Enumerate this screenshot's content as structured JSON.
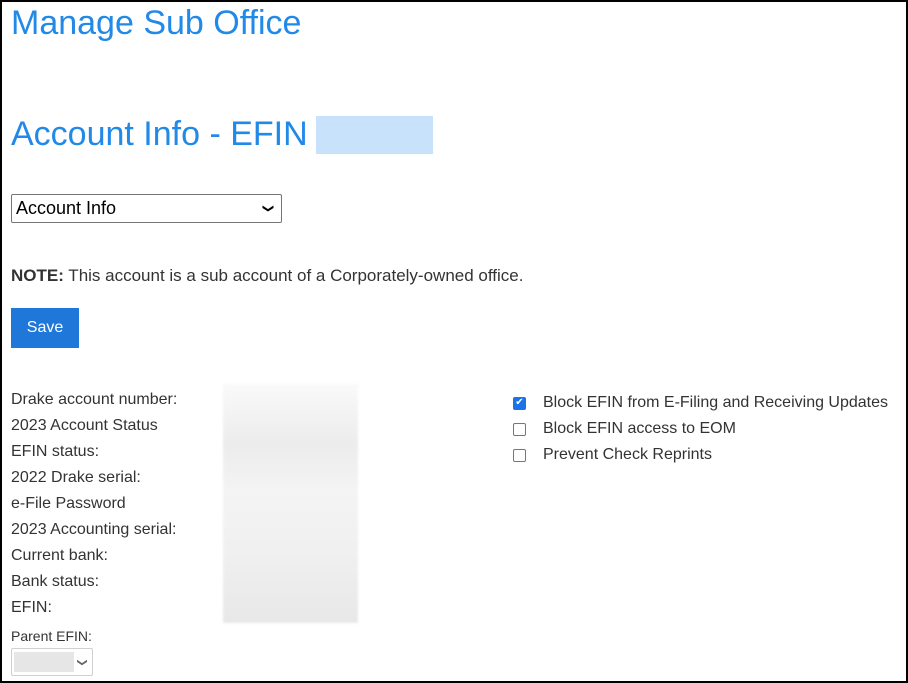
{
  "page": {
    "title": "Manage Sub Office",
    "subtitle": "Account Info - EFIN"
  },
  "section_select": {
    "value": "Account Info",
    "icon": "chevron-down-icon"
  },
  "note": {
    "label": "NOTE:",
    "text": " This account is a sub account of a Corporately-owned office."
  },
  "toolbar": {
    "save_label": "Save"
  },
  "fields": [
    {
      "label": "Drake account number:"
    },
    {
      "label": "2023 Account Status"
    },
    {
      "label": "EFIN status:"
    },
    {
      "label": "2022 Drake serial:"
    },
    {
      "label": "e-File Password"
    },
    {
      "label": "2023 Accounting serial:"
    },
    {
      "label": "Current bank:"
    },
    {
      "label": "Bank status:"
    },
    {
      "label": "EFIN:"
    }
  ],
  "parent_efin": {
    "label": "Parent EFIN:"
  },
  "options": [
    {
      "label": "Block EFIN from E-Filing and Receiving Updates",
      "checked": true
    },
    {
      "label": "Block EFIN access to EOM",
      "checked": false
    },
    {
      "label": "Prevent Check Reprints",
      "checked": false
    }
  ],
  "colors": {
    "heading": "#2189e8",
    "button": "#1f77d9"
  }
}
